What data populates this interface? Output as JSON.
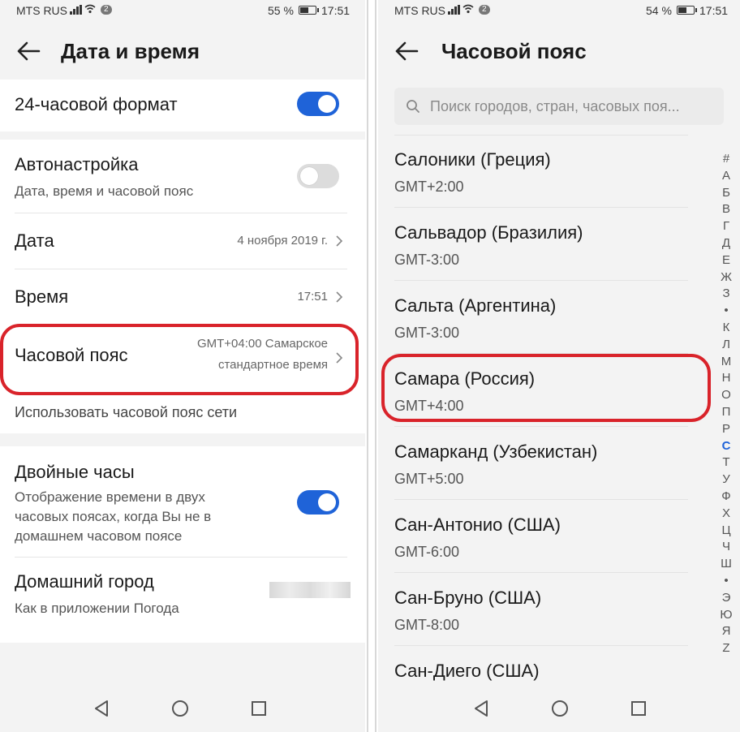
{
  "left_screen": {
    "status": {
      "carrier": "MTS RUS",
      "notif_count": "2",
      "battery": "55 %",
      "battery_level": 0.55,
      "time": "17:51"
    },
    "appbar": {
      "title": "Дата и время"
    },
    "settings": {
      "format24": {
        "label": "24-часовой формат",
        "enabled": true
      },
      "auto": {
        "label": "Автонастройка",
        "sub": "Дата, время и часовой пояс",
        "enabled": false
      },
      "date": {
        "label": "Дата",
        "value": "4 ноября 2019 г."
      },
      "time": {
        "label": "Время",
        "value": "17:51"
      },
      "timezone": {
        "label": "Часовой пояс",
        "value_line1": "GMT+04:00 Самарское",
        "value_line2": "стандартное время"
      },
      "use_network_tz": {
        "label": "Использовать часовой пояс сети"
      },
      "dual_clock": {
        "label": "Двойные часы",
        "sub_line1": "Отображение времени в двух",
        "sub_line2": "часовых поясах, когда Вы не в",
        "sub_line3": "домашнем часовом поясе",
        "enabled": true
      },
      "home_city": {
        "label": "Домашний город",
        "sub": "Как в приложении Погода"
      }
    }
  },
  "right_screen": {
    "status": {
      "carrier": "MTS RUS",
      "notif_count": "2",
      "battery": "54 %",
      "battery_level": 0.54,
      "time": "17:51"
    },
    "appbar": {
      "title": "Часовой пояс"
    },
    "search": {
      "placeholder": "Поиск городов, стран, часовых поя..."
    },
    "timezones": [
      {
        "city": "Салоники (Греция)",
        "gmt": "GMT+2:00"
      },
      {
        "city": "Сальвадор (Бразилия)",
        "gmt": "GMT-3:00"
      },
      {
        "city": "Сальта (Аргентина)",
        "gmt": "GMT-3:00"
      },
      {
        "city": "Самара (Россия)",
        "gmt": "GMT+4:00"
      },
      {
        "city": "Самарканд (Узбекистан)",
        "gmt": "GMT+5:00"
      },
      {
        "city": "Сан-Антонио (США)",
        "gmt": "GMT-6:00"
      },
      {
        "city": "Сан-Бруно (США)",
        "gmt": "GMT-8:00"
      },
      {
        "city": "Сан-Диего (США)",
        "gmt": ""
      }
    ],
    "alpha_index": [
      "#",
      "А",
      "Б",
      "В",
      "Г",
      "Д",
      "Е",
      "Ж",
      "З",
      "•",
      "К",
      "Л",
      "М",
      "Н",
      "О",
      "П",
      "Р",
      "С",
      "Т",
      "У",
      "Ф",
      "Х",
      "Ц",
      "Ч",
      "Ш",
      "•",
      "Э",
      "Ю",
      "Я",
      "Z"
    ],
    "alpha_active": "С"
  },
  "colors": {
    "accent": "#1f63d8",
    "highlight": "#d9232a",
    "background": "#f3f3f3"
  },
  "icons": {
    "back": "arrow-left-icon",
    "chevron": "chevron-right-icon",
    "search": "search-icon",
    "nav_back": "triangle-back-icon",
    "nav_home": "circle-home-icon",
    "nav_recents": "square-recents-icon"
  }
}
